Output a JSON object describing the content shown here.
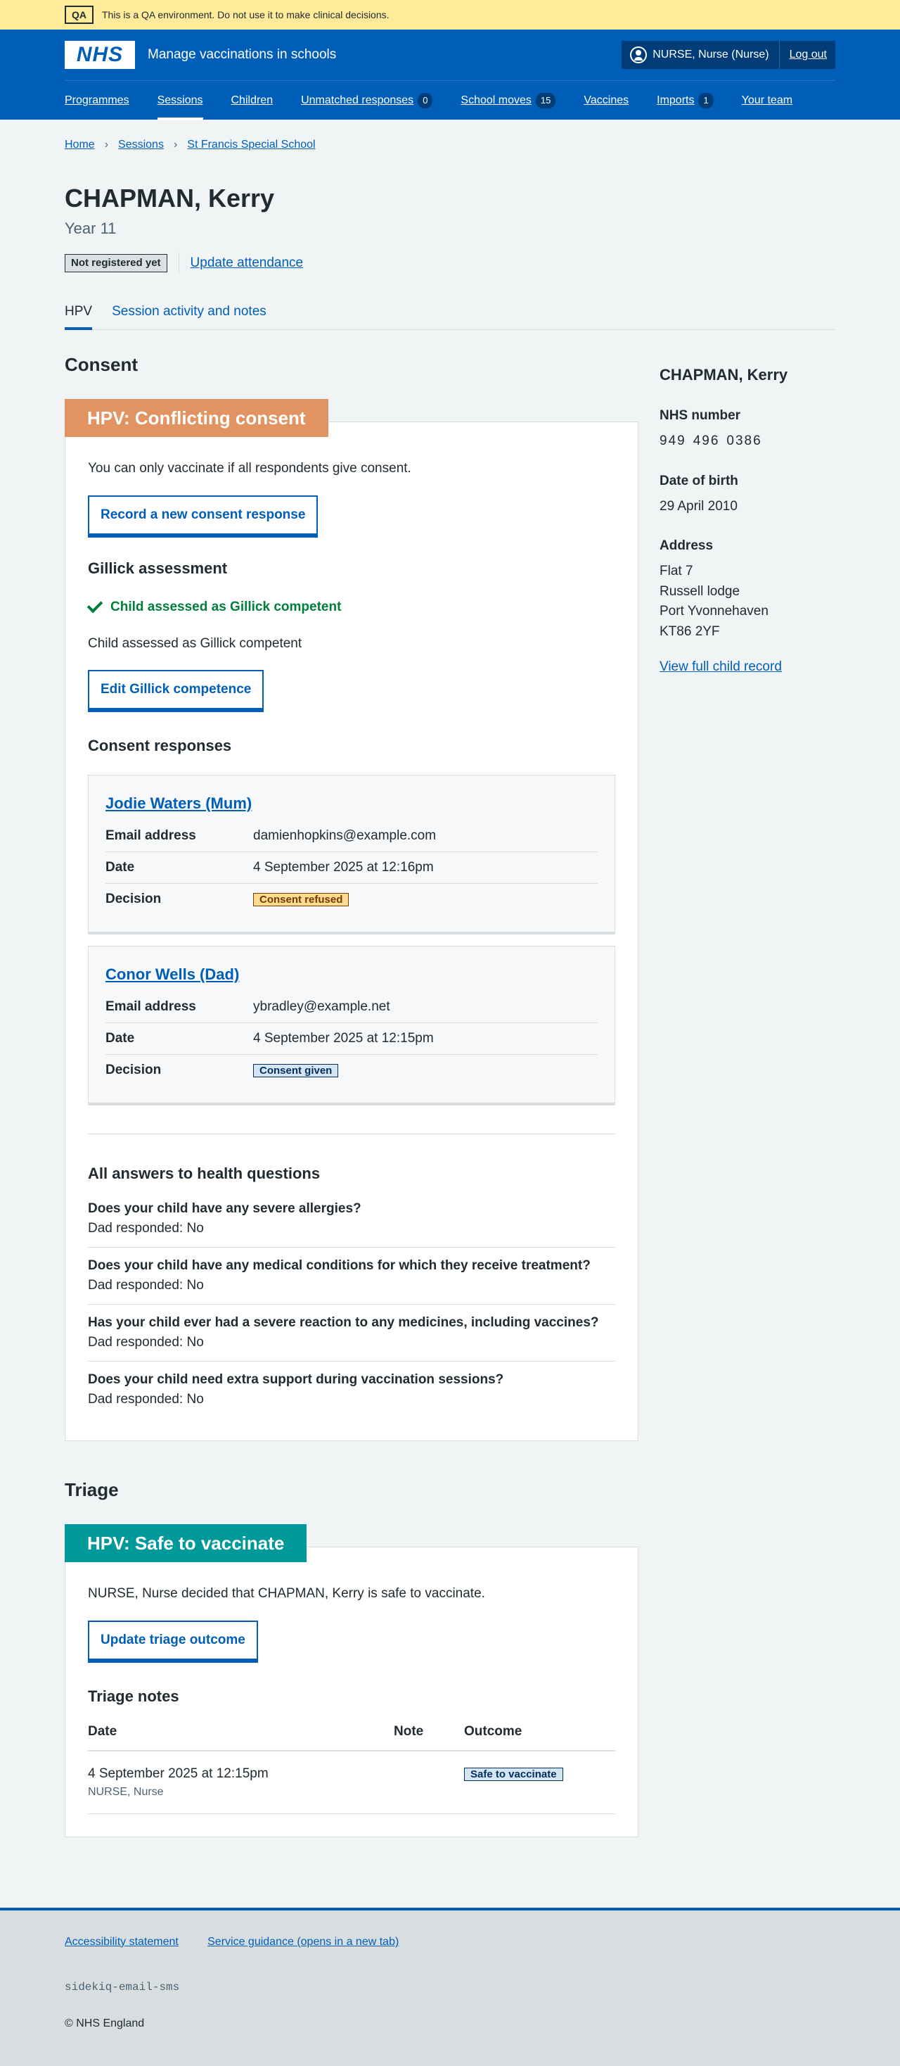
{
  "qa_banner": {
    "tag": "QA",
    "text": "This is a QA environment. Do not use it to make clinical decisions."
  },
  "header": {
    "logo": "NHS",
    "service_name": "Manage vaccinations in schools",
    "user": "NURSE, Nurse (Nurse)",
    "logout": "Log out"
  },
  "nav": {
    "items": [
      {
        "label": "Programmes"
      },
      {
        "label": "Sessions"
      },
      {
        "label": "Children"
      },
      {
        "label": "Unmatched responses",
        "count": "0"
      },
      {
        "label": "School moves",
        "count": "15"
      },
      {
        "label": "Vaccines"
      },
      {
        "label": "Imports",
        "count": "1"
      },
      {
        "label": "Your team"
      }
    ]
  },
  "breadcrumb": [
    "Home",
    "Sessions",
    "St Francis Special School"
  ],
  "patient": {
    "name": "CHAPMAN, Kerry",
    "year": "Year 11",
    "registration_tag": "Not registered yet",
    "update_attendance": "Update attendance"
  },
  "tabs": [
    "HPV",
    "Session activity and notes"
  ],
  "consent": {
    "section_title": "Consent",
    "card_heading": "HPV: Conflicting consent",
    "message": "You can only vaccinate if all respondents give consent.",
    "record_button": "Record a new consent response",
    "gillick_title": "Gillick assessment",
    "gillick_status": "Child assessed as Gillick competent",
    "gillick_text": "Child assessed as Gillick competent",
    "gillick_button": "Edit Gillick competence",
    "responses_title": "Consent responses",
    "labels": {
      "email": "Email address",
      "date": "Date",
      "decision": "Decision"
    },
    "responses": [
      {
        "name": "Jodie Waters (Mum)",
        "email": "damienhopkins@example.com",
        "date": "4 September 2025 at 12:16pm",
        "decision": "Consent refused"
      },
      {
        "name": "Conor Wells (Dad)",
        "email": "ybradley@example.net",
        "date": "4 September 2025 at 12:15pm",
        "decision": "Consent given"
      }
    ],
    "health_title": "All answers to health questions",
    "health_questions": [
      {
        "q": "Does your child have any severe allergies?",
        "a": "Dad responded: No"
      },
      {
        "q": "Does your child have any medical conditions for which they receive treatment?",
        "a": "Dad responded: No"
      },
      {
        "q": "Has your child ever had a severe reaction to any medicines, including vaccines?",
        "a": "Dad responded: No"
      },
      {
        "q": "Does your child need extra support during vaccination sessions?",
        "a": "Dad responded: No"
      }
    ]
  },
  "triage": {
    "section_title": "Triage",
    "card_heading": "HPV: Safe to vaccinate",
    "message": "NURSE, Nurse decided that CHAPMAN, Kerry is safe to vaccinate.",
    "button": "Update triage outcome",
    "notes_title": "Triage notes",
    "columns": [
      "Date",
      "Note",
      "Outcome"
    ],
    "rows": [
      {
        "date": "4 September 2025 at 12:15pm",
        "by": "NURSE, Nurse",
        "note": "",
        "outcome": "Safe to vaccinate"
      }
    ]
  },
  "sidebar": {
    "name": "CHAPMAN, Kerry",
    "nhs_label": "NHS number",
    "nhs_number": [
      "949",
      "496",
      "0386"
    ],
    "dob_label": "Date of birth",
    "dob": "29 April 2010",
    "address_label": "Address",
    "address": [
      "Flat 7",
      "Russell lodge",
      "Port Yvonnehaven",
      "KT86 2YF"
    ],
    "view_record": "View full child record"
  },
  "footer": {
    "links": [
      "Accessibility statement",
      "Service guidance (opens in a new tab)"
    ],
    "mono": "sidekiq-email-sms",
    "copyright": "© NHS England"
  },
  "colors": {
    "brand": "#005eb8",
    "conflict": "#e19361",
    "safe": "#009999",
    "success": "#007f3b"
  }
}
